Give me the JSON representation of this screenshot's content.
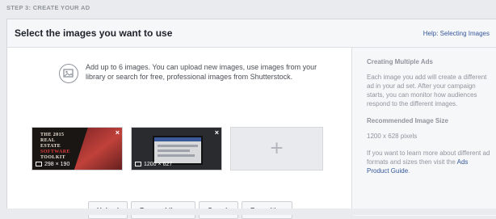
{
  "step_label": "STEP 3: CREATE YOUR AD",
  "header": {
    "title": "Select the images you want to use",
    "help_link": "Help: Selecting Images"
  },
  "intro": "Add up to 6 images. You can upload new images, use images from your library or search for free, professional images from Shutterstock.",
  "icons": {
    "upload": "image-upload-icon",
    "close": "close-icon",
    "dimension": "image-size-icon",
    "add": "plus-icon"
  },
  "thumbnails": [
    {
      "dimensions": "298 × 190",
      "poster_lines": [
        "THE 2015",
        "REAL",
        "ESTATE",
        "SOFTWARE",
        "TOOLKIT"
      ]
    },
    {
      "dimensions": "1200 × 627"
    }
  ],
  "empty_slot_symbol": "+",
  "close_symbol": "×",
  "buttons": {
    "upload": "Upload",
    "browse": "Browse Library",
    "search": "Search",
    "reposition": "Reposition"
  },
  "sidebar": {
    "heading1": "Creating Multiple Ads",
    "para1": "Each image you add will create a different ad in your ad set. After your campaign starts, you can monitor how audiences respond to the different images.",
    "heading2": "Recommended Image Size",
    "size": "1200 x 628 pixels",
    "para3_prefix": "If you want to learn more about different ad formats and sizes then visit the ",
    "link": "Ads Product Guide",
    "para3_suffix": "."
  },
  "colors": {
    "link": "#365899",
    "background": "#e9ebee",
    "muted_text": "#90949c"
  }
}
